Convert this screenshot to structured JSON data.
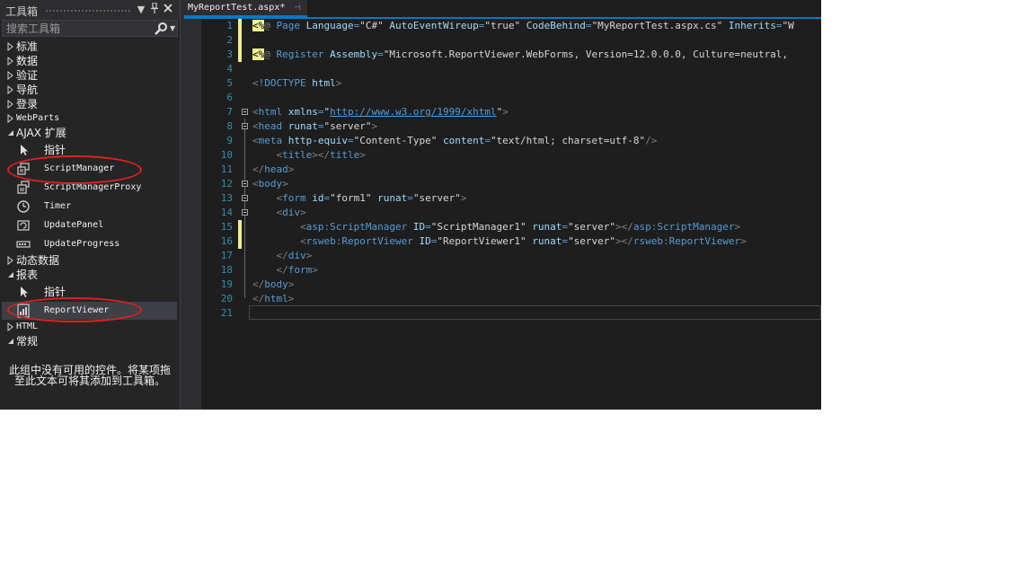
{
  "toolbox": {
    "title": "工具箱",
    "search_placeholder": "搜索工具箱",
    "groups": {
      "standard": "标准",
      "data": "数据",
      "validation": "验证",
      "navigation": "导航",
      "login": "登录",
      "webparts": "WebParts",
      "ajax": "AJAX 扩展",
      "dynamic_data": "动态数据",
      "reporting": "报表",
      "html": "HTML",
      "general": "常规"
    },
    "ajax_items": [
      "指针",
      "ScriptManager",
      "ScriptManagerProxy",
      "Timer",
      "UpdatePanel",
      "UpdateProgress"
    ],
    "reporting_items": [
      "指针",
      "ReportViewer"
    ],
    "empty_message": "此组中没有可用的控件。将某项拖至此文本可将其添加到工具箱。",
    "highlight_color": "#e02020"
  },
  "editor": {
    "tab_label": "MyReportTest.aspx*",
    "line_numbers": [
      "1",
      "2",
      "3",
      "4",
      "5",
      "6",
      "7",
      "8",
      "9",
      "10",
      "11",
      "12",
      "13",
      "14",
      "15",
      "16",
      "17",
      "18",
      "19",
      "20",
      "21"
    ],
    "code": {
      "l1": {
        "dir_open": "<%",
        "dir_at": "@",
        "kw": "Page",
        "a1": "Language",
        "v1": "\"C#\"",
        "a2": "AutoEventWireup",
        "v2": "\"true\"",
        "a3": "CodeBehind",
        "v3": "\"MyReportTest.aspx.cs\"",
        "a4": "Inherits",
        "v4": "\"W"
      },
      "l3": {
        "dir_open": "<%",
        "dir_at": "@",
        "kw": "Register",
        "a1": "Assembly",
        "v1": "\"Microsoft.ReportViewer.WebForms, Version=12.0.0.0, Culture=neutral,"
      },
      "l5": {
        "doctype": "!DOCTYPE",
        "kw": "html"
      },
      "l7": {
        "tag": "html",
        "attr": "xmlns",
        "url": "http://www.w3.org/1999/xhtml"
      },
      "l8": {
        "tag": "head",
        "attr": "runat",
        "val": "\"server\""
      },
      "l9": {
        "tag": "meta",
        "a1": "http-equiv",
        "v1": "\"Content-Type\"",
        "a2": "content",
        "v2": "\"text/html; charset=utf-8\""
      },
      "l10": {
        "tag": "title"
      },
      "l11": {
        "tag": "head"
      },
      "l12": {
        "tag": "body"
      },
      "l13": {
        "tag": "form",
        "a1": "id",
        "v1": "\"form1\"",
        "a2": "runat",
        "v2": "\"server\""
      },
      "l14": {
        "tag": "div"
      },
      "l15": {
        "prefix": "asp",
        "tag": "ScriptManager",
        "a1": "ID",
        "v1": "\"ScriptManager1\"",
        "a2": "runat",
        "v2": "\"server\""
      },
      "l16": {
        "prefix": "rsweb",
        "tag": "ReportViewer",
        "a1": "ID",
        "v1": "\"ReportViewer1\"",
        "a2": "runat",
        "v2": "\"server\""
      },
      "l17": {
        "tag": "div"
      },
      "l18": {
        "tag": "form"
      },
      "l19": {
        "tag": "body"
      },
      "l20": {
        "tag": "html"
      }
    }
  },
  "colors": {
    "editor_bg": "#1e1e1e",
    "panel_bg": "#252526",
    "accent": "#007acc",
    "tag": "#569cd6",
    "attribute": "#9cdcfe",
    "line_number": "#2b91af",
    "directive_bg": "#efef92"
  }
}
